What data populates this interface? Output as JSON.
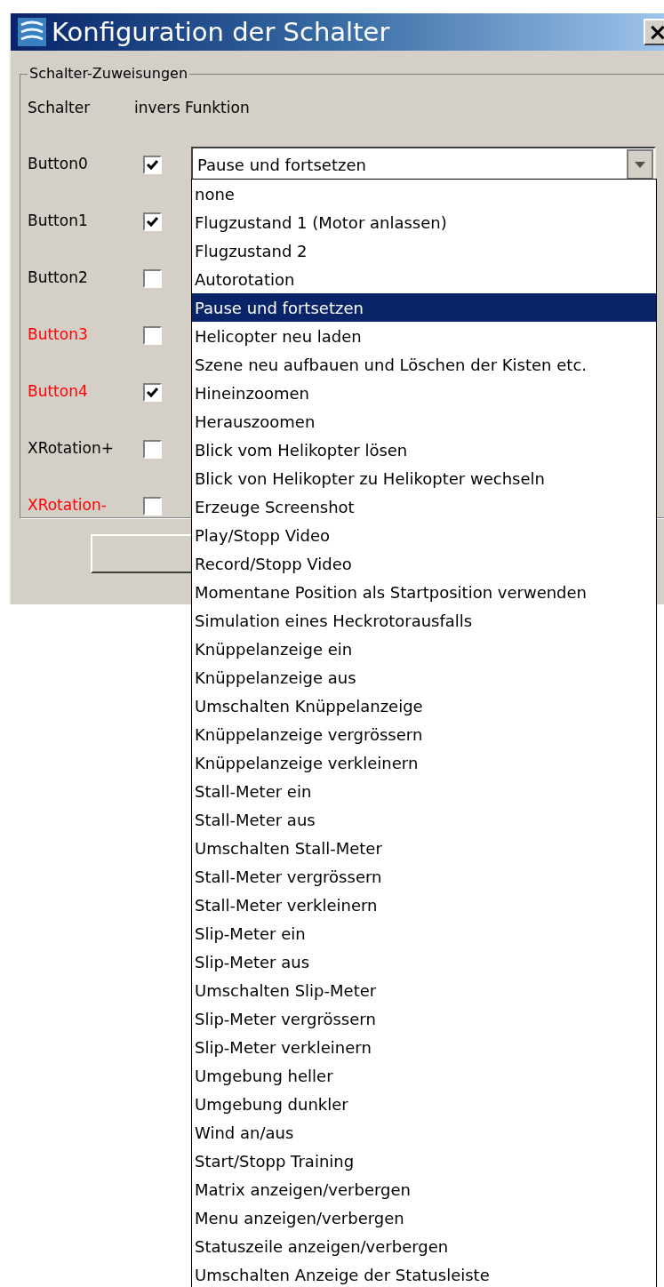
{
  "window": {
    "title": "Konfiguration der Schalter",
    "close_label": "×"
  },
  "group": {
    "title": "Schalter-Zuweisungen",
    "columns": [
      "Schalter",
      "invers",
      "Funktion"
    ]
  },
  "rows": [
    {
      "name": "Button0",
      "color": "#000000",
      "inverse": true
    },
    {
      "name": "Button1",
      "color": "#000000",
      "inverse": true
    },
    {
      "name": "Button2",
      "color": "#000000",
      "inverse": false
    },
    {
      "name": "Button3",
      "color": "#ff0000",
      "inverse": false
    },
    {
      "name": "Button4",
      "color": "#ff0000",
      "inverse": true
    },
    {
      "name": "XRotation+",
      "color": "#000000",
      "inverse": false
    },
    {
      "name": "XRotation-",
      "color": "#ff0000",
      "inverse": false
    }
  ],
  "combo": {
    "value": "Pause und fortsetzen",
    "expanded": true
  },
  "options": [
    {
      "label": "none",
      "selected": false
    },
    {
      "label": "Flugzustand 1 (Motor anlassen)",
      "selected": false
    },
    {
      "label": "Flugzustand 2",
      "selected": false
    },
    {
      "label": "Autorotation",
      "selected": false
    },
    {
      "label": "Pause und fortsetzen",
      "selected": true
    },
    {
      "label": "Helicopter neu laden",
      "selected": false
    },
    {
      "label": "Szene neu aufbauen und Löschen der Kisten etc.",
      "selected": false
    },
    {
      "label": "Hineinzoomen",
      "selected": false
    },
    {
      "label": "Herauszoomen",
      "selected": false
    },
    {
      "label": "Blick vom Helikopter lösen",
      "selected": false
    },
    {
      "label": "Blick von Helikopter zu Helikopter wechseln",
      "selected": false
    },
    {
      "label": "Erzeuge Screenshot",
      "selected": false
    },
    {
      "label": "Play/Stopp Video",
      "selected": false
    },
    {
      "label": "Record/Stopp Video",
      "selected": false
    },
    {
      "label": "Momentane Position als Startposition verwenden",
      "selected": false
    },
    {
      "label": "Simulation eines Heckrotorausfalls",
      "selected": false
    },
    {
      "label": "Knüppelanzeige ein",
      "selected": false
    },
    {
      "label": "Knüppelanzeige aus",
      "selected": false
    },
    {
      "label": "Umschalten Knüppelanzeige",
      "selected": false
    },
    {
      "label": "Knüppelanzeige vergrössern",
      "selected": false
    },
    {
      "label": "Knüppelanzeige verkleinern",
      "selected": false
    },
    {
      "label": "Stall-Meter ein",
      "selected": false
    },
    {
      "label": "Stall-Meter aus",
      "selected": false
    },
    {
      "label": "Umschalten Stall-Meter",
      "selected": false
    },
    {
      "label": "Stall-Meter vergrössern",
      "selected": false
    },
    {
      "label": "Stall-Meter verkleinern",
      "selected": false
    },
    {
      "label": "Slip-Meter ein",
      "selected": false
    },
    {
      "label": "Slip-Meter aus",
      "selected": false
    },
    {
      "label": "Umschalten Slip-Meter",
      "selected": false
    },
    {
      "label": "Slip-Meter vergrössern",
      "selected": false
    },
    {
      "label": "Slip-Meter verkleinern",
      "selected": false
    },
    {
      "label": "Umgebung heller",
      "selected": false
    },
    {
      "label": "Umgebung dunkler",
      "selected": false
    },
    {
      "label": "Wind an/aus",
      "selected": false
    },
    {
      "label": "Start/Stopp Training",
      "selected": false
    },
    {
      "label": "Matrix anzeigen/verbergen",
      "selected": false
    },
    {
      "label": "Menu anzeigen/verbergen",
      "selected": false
    },
    {
      "label": "Statuszeile anzeigen/verbergen",
      "selected": false
    },
    {
      "label": "Umschalten Anzeige der Statusleiste",
      "selected": false
    }
  ]
}
